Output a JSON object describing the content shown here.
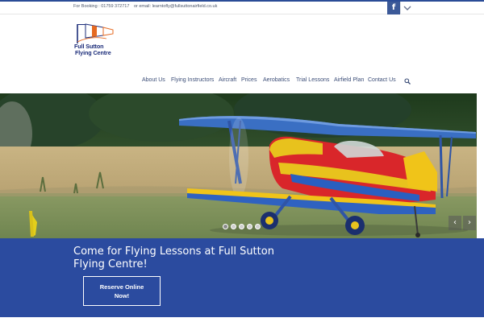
{
  "topbar": {
    "booking": "For Booking : 01759 372717",
    "email": "or email: learntofly@fullsuttonairfield.co.uk",
    "social_icon": "facebook-icon",
    "social_label": "f"
  },
  "logo": {
    "line1": "Full Sutton",
    "line2": "Flying Centre"
  },
  "nav": {
    "items": [
      "About Us",
      "Flying Instructors",
      "Aircraft",
      "Prices",
      "Aerobatics",
      "Trial Lessons",
      "Airfield Plan",
      "Contact Us"
    ],
    "search_icon": "search-icon"
  },
  "slider": {
    "prev": "‹",
    "next": "›",
    "slide_count": 5,
    "active_slide": 1
  },
  "cta": {
    "headline": "Come for Flying Lessons at Full Sutton Flying Centre!",
    "button_line1": "Reserve Online",
    "button_line2": "Now!"
  },
  "colors": {
    "brand_blue": "#2b4b9f",
    "nav_text": "#3b4d77",
    "facebook": "#3b5998"
  }
}
